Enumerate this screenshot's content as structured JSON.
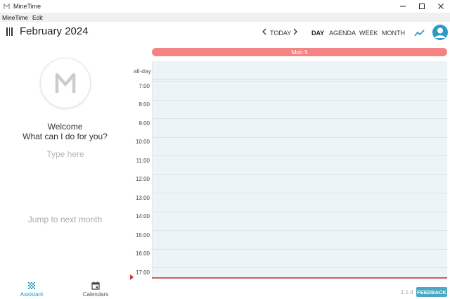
{
  "window": {
    "title": "MineTime",
    "controls": [
      "minimize-icon",
      "maximize-icon",
      "close-icon"
    ]
  },
  "menu": {
    "items": [
      "MineTime",
      "Edit"
    ]
  },
  "header": {
    "month": "February",
    "year": "2024",
    "today_label": "TODAY",
    "views": [
      "DAY",
      "AGENDA",
      "WEEK",
      "MONTH"
    ],
    "active_view": "DAY",
    "accent_color": "#2b9bc1"
  },
  "calendar": {
    "day_label": "Mon 5",
    "allday_label": "all-day",
    "hours": [
      "7:00",
      "8:00",
      "9:00",
      "10:00",
      "11:00",
      "12:00",
      "13:00",
      "14:00",
      "15:00",
      "16:00",
      "17:00"
    ],
    "day_pill_color": "#f48383",
    "now_line_color": "#e05a5a"
  },
  "assistant": {
    "welcome": "Welcome",
    "question": "What can I do for you?",
    "input_placeholder": "Type here",
    "suggestion": "Jump to next month"
  },
  "bottom_nav": {
    "items": [
      {
        "label": "Assistant",
        "icon": "assistant-icon",
        "active": true
      },
      {
        "label": "Calendars",
        "icon": "calendar-icon",
        "active": false
      }
    ]
  },
  "footer": {
    "version": "1.1.4",
    "feedback_label": "FEEDBACK"
  }
}
